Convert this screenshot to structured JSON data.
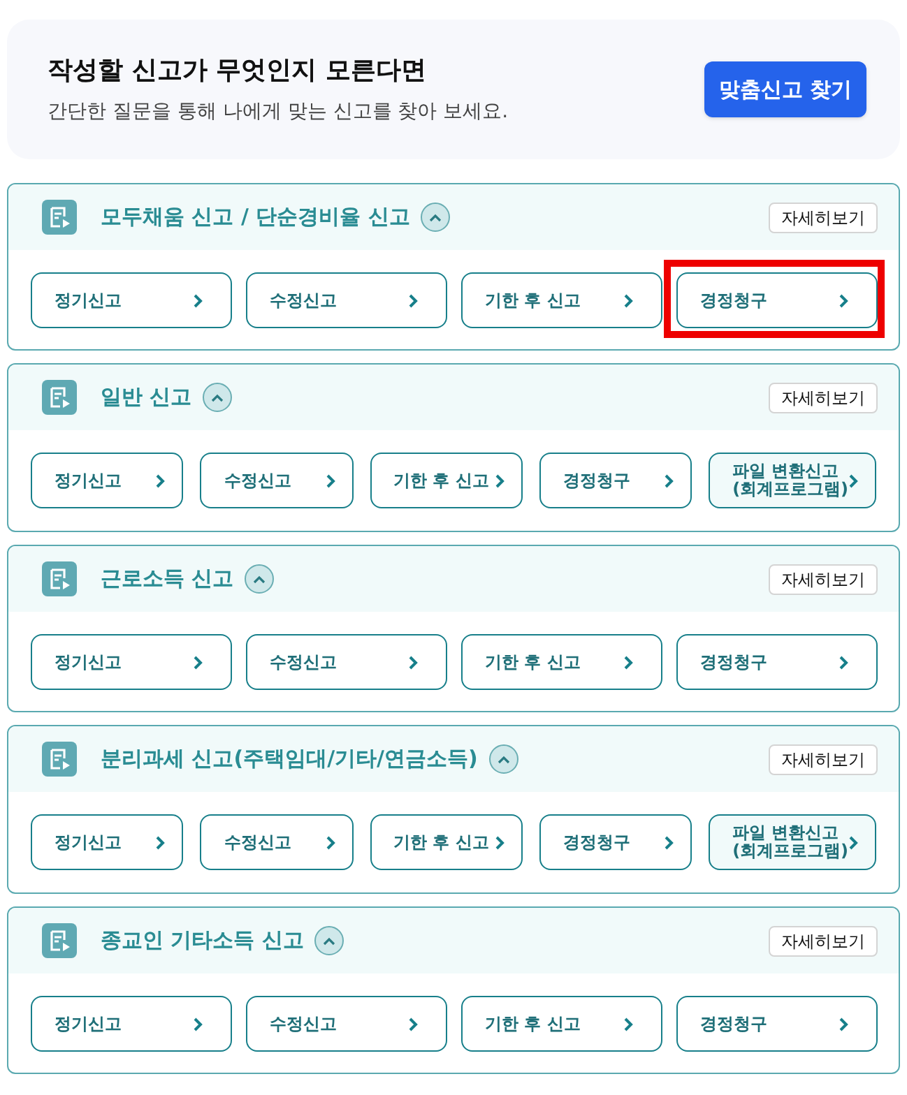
{
  "banner": {
    "title": "작성할 신고가 무엇인지 모른다면",
    "subtitle": "간단한 질문을 통해 나에게 맞는 신고를 찾아 보세요.",
    "button": "맞춤신고 찾기"
  },
  "sections": [
    {
      "title": "모두채움 신고 / 단순경비율 신고",
      "expanded": true,
      "details": "자세히보기",
      "buttons": [
        {
          "label": "정기신고",
          "shaded": false,
          "highlighted": false
        },
        {
          "label": "수정신고",
          "shaded": false,
          "highlighted": false
        },
        {
          "label": "기한 후 신고",
          "shaded": false,
          "highlighted": false
        },
        {
          "label": "경정청구",
          "shaded": false,
          "highlighted": true
        }
      ]
    },
    {
      "title": "일반 신고",
      "expanded": true,
      "details": "자세히보기",
      "buttons": [
        {
          "label": "정기신고",
          "shaded": false,
          "highlighted": false
        },
        {
          "label": "수정신고",
          "shaded": false,
          "highlighted": false
        },
        {
          "label": "기한 후 신고",
          "shaded": false,
          "highlighted": false
        },
        {
          "label": "경정청구",
          "shaded": false,
          "highlighted": false
        },
        {
          "label": "파일 변환신고\n(회계프로그램)",
          "shaded": true,
          "highlighted": false
        }
      ]
    },
    {
      "title": "근로소득 신고",
      "expanded": true,
      "details": "자세히보기",
      "buttons": [
        {
          "label": "정기신고",
          "shaded": false,
          "highlighted": false
        },
        {
          "label": "수정신고",
          "shaded": false,
          "highlighted": false
        },
        {
          "label": "기한 후 신고",
          "shaded": false,
          "highlighted": false
        },
        {
          "label": "경정청구",
          "shaded": false,
          "highlighted": false
        }
      ]
    },
    {
      "title": "분리과세 신고(주택임대/기타/연금소득)",
      "expanded": true,
      "details": "자세히보기",
      "buttons": [
        {
          "label": "정기신고",
          "shaded": false,
          "highlighted": false
        },
        {
          "label": "수정신고",
          "shaded": false,
          "highlighted": false
        },
        {
          "label": "기한 후 신고",
          "shaded": false,
          "highlighted": false
        },
        {
          "label": "경정청구",
          "shaded": false,
          "highlighted": false
        },
        {
          "label": "파일 변환신고\n(회계프로그램)",
          "shaded": true,
          "highlighted": false
        }
      ]
    },
    {
      "title": "종교인 기타소득 신고",
      "expanded": true,
      "details": "자세히보기",
      "buttons": [
        {
          "label": "정기신고",
          "shaded": false,
          "highlighted": false
        },
        {
          "label": "수정신고",
          "shaded": false,
          "highlighted": false
        },
        {
          "label": "기한 후 신고",
          "shaded": false,
          "highlighted": false
        },
        {
          "label": "경정청구",
          "shaded": false,
          "highlighted": false
        }
      ]
    }
  ]
}
